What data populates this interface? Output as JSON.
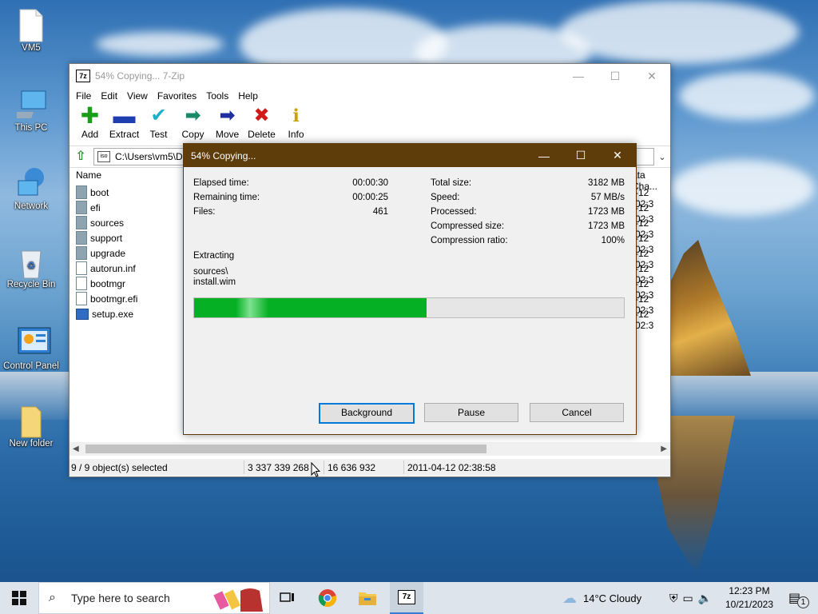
{
  "desktop": {
    "icons": [
      {
        "label": "VM5",
        "icon": "file-icon"
      },
      {
        "label": "This PC",
        "icon": "computer-icon"
      },
      {
        "label": "Network",
        "icon": "network-icon"
      },
      {
        "label": "Recycle Bin",
        "icon": "recycle-bin-icon"
      },
      {
        "label": "Control Panel",
        "icon": "control-panel-icon"
      },
      {
        "label": "New folder",
        "icon": "folder-icon"
      }
    ]
  },
  "main_window": {
    "title": "54% Copying... 7-Zip",
    "logo": "7z",
    "menu": [
      "File",
      "Edit",
      "View",
      "Favorites",
      "Tools",
      "Help"
    ],
    "toolbar": [
      {
        "label": "Add",
        "icon": "plus-icon",
        "color": "#1a9e1a"
      },
      {
        "label": "Extract",
        "icon": "minus-icon",
        "color": "#1f3fb0"
      },
      {
        "label": "Test",
        "icon": "check-icon",
        "color": "#1ab0c8"
      },
      {
        "label": "Copy",
        "icon": "copy-arrow-icon",
        "color": "#1a8a6a"
      },
      {
        "label": "Move",
        "icon": "move-arrow-icon",
        "color": "#1f2f9f"
      },
      {
        "label": "Delete",
        "icon": "delete-x-icon",
        "color": "#d11a1a"
      },
      {
        "label": "Info",
        "icon": "info-icon",
        "color": "#d7b000"
      }
    ],
    "address": "C:\\Users\\vm5\\D",
    "columns": {
      "name": "Name",
      "date": "ata Cha..."
    },
    "files": [
      {
        "name": "boot",
        "type": "folder",
        "date": "-12 02:3"
      },
      {
        "name": "efi",
        "type": "folder",
        "date": "-12 02:3"
      },
      {
        "name": "sources",
        "type": "folder",
        "date": "-12 02:3"
      },
      {
        "name": "support",
        "type": "folder",
        "date": "-12 02:3"
      },
      {
        "name": "upgrade",
        "type": "folder",
        "date": "-12 02:3"
      },
      {
        "name": "autorun.inf",
        "type": "file",
        "date": "-12 02:3"
      },
      {
        "name": "bootmgr",
        "type": "file",
        "date": "-12 02:3"
      },
      {
        "name": "bootmgr.efi",
        "type": "file",
        "date": "-12 02:3"
      },
      {
        "name": "setup.exe",
        "type": "exe",
        "date": "-12 02:3"
      }
    ],
    "status": {
      "selected": "9 / 9 object(s) selected",
      "size": "3 337 339 268",
      "packed": "16 636 932",
      "modified": "2011-04-12 02:38:58"
    }
  },
  "progress_dialog": {
    "title": "54% Copying...",
    "left": [
      {
        "label": "Elapsed time:",
        "value": "00:00:30"
      },
      {
        "label": "Remaining time:",
        "value": "00:00:25"
      },
      {
        "label": "Files:",
        "value": "461"
      }
    ],
    "right": [
      {
        "label": "Total size:",
        "value": "3182 MB"
      },
      {
        "label": "Speed:",
        "value": "57 MB/s"
      },
      {
        "label": "Processed:",
        "value": "1723 MB"
      },
      {
        "label": "Compressed size:",
        "value": "1723 MB"
      },
      {
        "label": "Compression ratio:",
        "value": "100%"
      }
    ],
    "operation": "Extracting",
    "current_path": "sources\\",
    "current_file": "install.wim",
    "progress_fraction": 0.54,
    "progress_color": "#06b025",
    "buttons": {
      "background": "Background",
      "pause": "Pause",
      "cancel": "Cancel"
    }
  },
  "taskbar": {
    "search_placeholder": "Type here to search",
    "weather": "14°C  Cloudy",
    "time": "12:23 PM",
    "date": "10/21/2023",
    "notification_count": "1"
  }
}
